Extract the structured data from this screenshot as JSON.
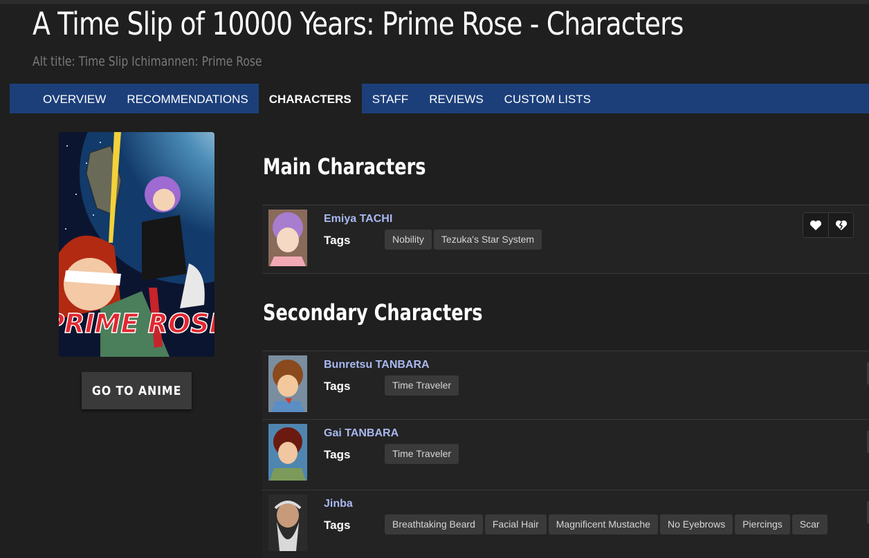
{
  "header": {
    "title": "A Time Slip of 10000 Years: Prime Rose - Characters",
    "alt_title": "Alt title: Time Slip Ichimannen: Prime Rose"
  },
  "nav": {
    "tabs": [
      {
        "label": "OVERVIEW",
        "active": false
      },
      {
        "label": "RECOMMENDATIONS",
        "active": false
      },
      {
        "label": "CHARACTERS",
        "active": true
      },
      {
        "label": "STAFF",
        "active": false
      },
      {
        "label": "REVIEWS",
        "active": false
      },
      {
        "label": "CUSTOM LISTS",
        "active": false
      }
    ]
  },
  "sidebar": {
    "cover_text": "PRIME ROSE",
    "goto_button": "GO TO ANIME"
  },
  "main": {
    "main_heading": "Main Characters",
    "secondary_heading": "Secondary Characters",
    "tags_label": "Tags",
    "main_characters": [
      {
        "name": "Emiya TACHI",
        "tags": [
          "Nobility",
          "Tezuka's Star System"
        ]
      }
    ],
    "secondary_characters": [
      {
        "name": "Bunretsu TANBARA",
        "tags": [
          "Time Traveler"
        ]
      },
      {
        "name": "Gai TANBARA",
        "tags": [
          "Time Traveler"
        ]
      },
      {
        "name": "Jinba",
        "tags": [
          "Breathtaking Beard",
          "Facial Hair",
          "Magnificent Mustache",
          "No Eyebrows",
          "Piercings",
          "Scar"
        ]
      }
    ]
  },
  "icons": {
    "favorite": "heart-icon",
    "unfavorite": "broken-heart-icon"
  },
  "colors": {
    "nav_bg": "#1c3f7a",
    "page_bg": "#1f1f1f",
    "link": "#a9b8f0",
    "tag_bg": "#3a3a3a"
  }
}
